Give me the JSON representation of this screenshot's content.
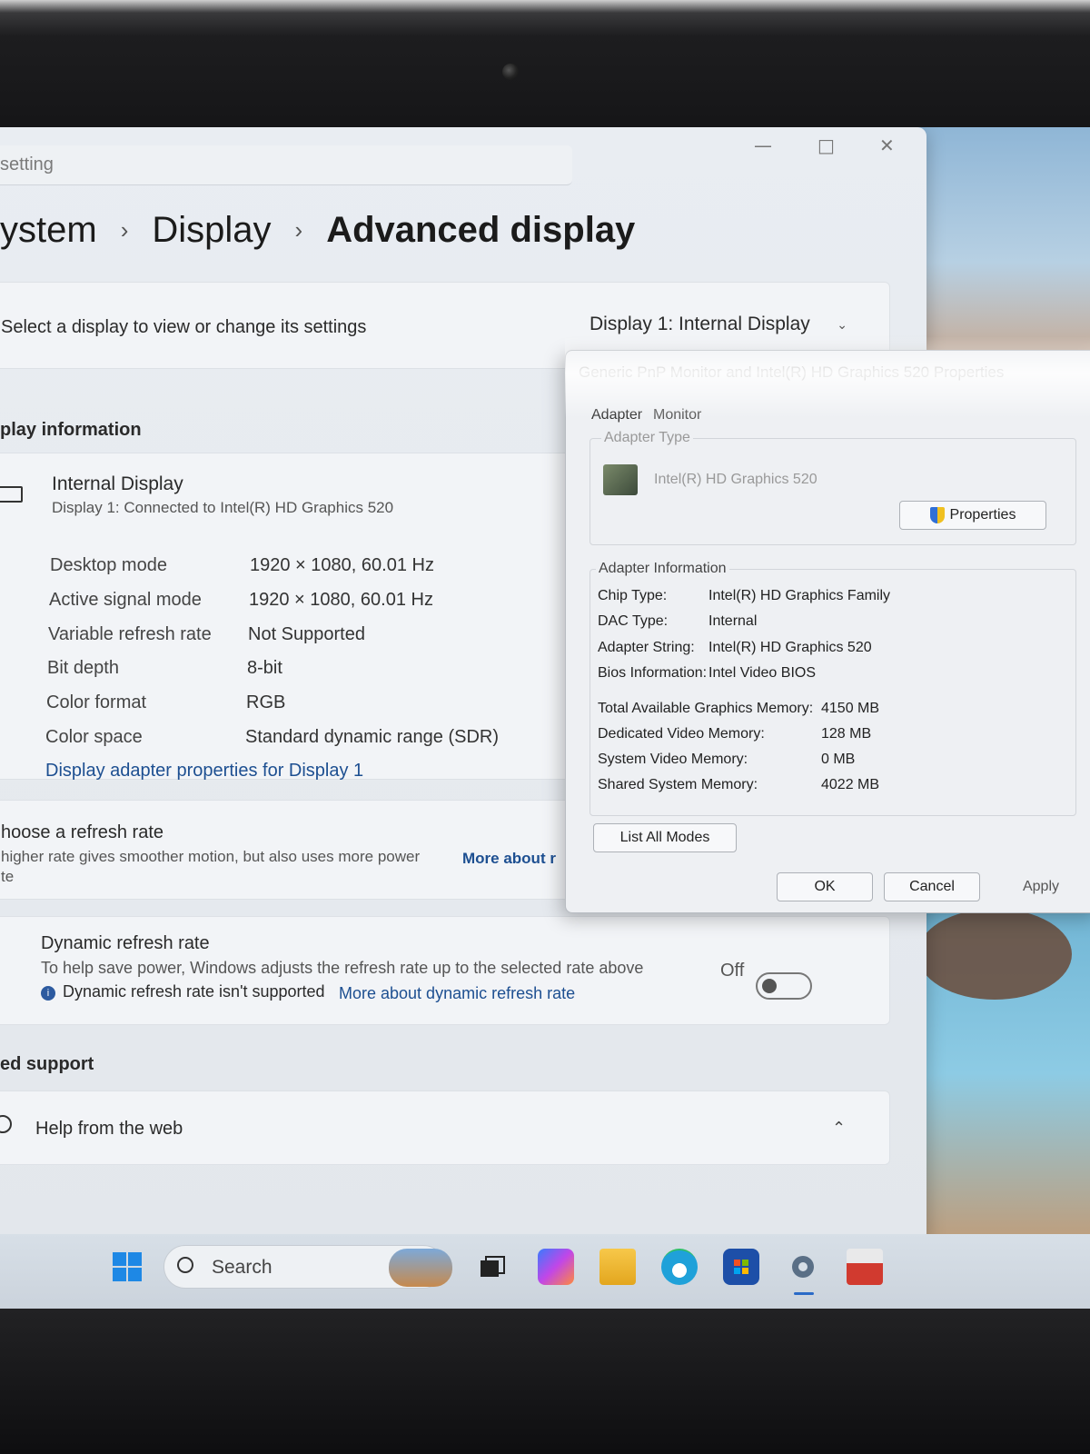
{
  "settings": {
    "search_placeholder": "setting",
    "breadcrumb": {
      "part1": "ystem",
      "part2": "Display",
      "current": "Advanced display"
    },
    "select_prompt": "Select a display to view or change its settings",
    "select_value": "Display 1: Internal Display",
    "display_info_heading": "play information",
    "display_name": "Internal Display",
    "display_sub": "Display 1: Connected to Intel(R) HD Graphics 520",
    "info_rows": [
      {
        "label": "Desktop mode",
        "value": "1920 × 1080, 60.01 Hz"
      },
      {
        "label": "Active signal mode",
        "value": "1920 × 1080, 60.01 Hz"
      },
      {
        "label": "Variable refresh rate",
        "value": "Not Supported"
      },
      {
        "label": "Bit depth",
        "value": "8-bit"
      },
      {
        "label": "Color format",
        "value": "RGB"
      },
      {
        "label": "Color space",
        "value": "Standard dynamic range (SDR)"
      }
    ],
    "adapter_link": "Display adapter properties for Display 1",
    "refresh_title": "hoose a refresh rate",
    "refresh_desc": "higher rate gives smoother motion, but also uses more power",
    "refresh_more": "More about r",
    "refresh_desc2": "te",
    "dynamic_title": "Dynamic refresh rate",
    "dynamic_desc": "To help save power, Windows adjusts the refresh rate up to the selected rate above",
    "dynamic_note": "Dynamic refresh rate isn't supported",
    "dynamic_more": "More about dynamic refresh rate",
    "toggle_state": "Off",
    "support_heading": "ed support",
    "help_web": "Help from the web"
  },
  "dialog": {
    "title": "Generic PnP Monitor and Intel(R) HD Graphics 520 Properties",
    "tabs": [
      "Adapter",
      "Monitor"
    ],
    "adapter_type_heading": "Adapter Type",
    "adapter_type_value": "Intel(R) HD Graphics 520",
    "properties_button": "Properties",
    "adapter_info_heading": "Adapter Information",
    "info": [
      {
        "label": "Chip Type:",
        "value": "Intel(R) HD Graphics Family"
      },
      {
        "label": "DAC Type:",
        "value": "Internal"
      },
      {
        "label": "Adapter String:",
        "value": "Intel(R) HD Graphics 520"
      },
      {
        "label": "Bios Information:",
        "value": "Intel Video BIOS"
      }
    ],
    "memory": [
      {
        "label": "Total Available Graphics Memory:",
        "value": "4150 MB"
      },
      {
        "label": "Dedicated Video Memory:",
        "value": "128 MB"
      },
      {
        "label": "System Video Memory:",
        "value": "0 MB"
      },
      {
        "label": "Shared System Memory:",
        "value": "4022 MB"
      }
    ],
    "list_modes_button": "List All Modes",
    "ok_button": "OK",
    "cancel_button": "Cancel",
    "apply_button": "Apply"
  },
  "taskbar": {
    "search_label": "Search",
    "icons": [
      "start-icon",
      "search-icon",
      "widgets-icon",
      "task-view-icon",
      "copilot-icon",
      "file-explorer-icon",
      "edge-icon",
      "store-icon",
      "settings-icon",
      "toolbox-icon"
    ]
  }
}
